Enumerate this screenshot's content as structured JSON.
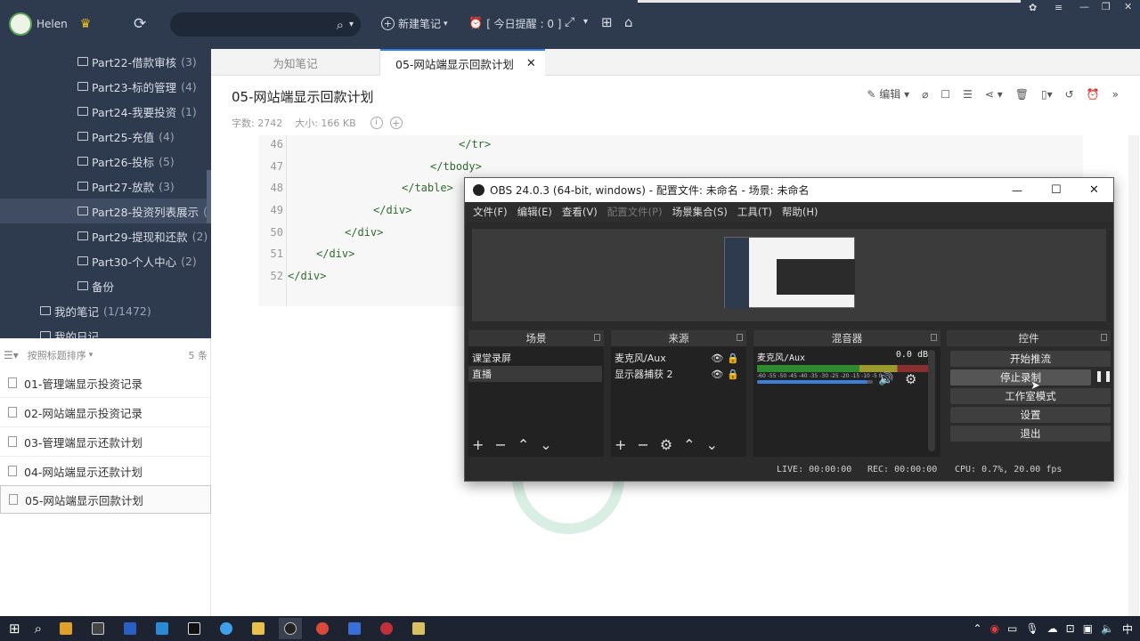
{
  "topbar": {
    "user": "Helen",
    "new_note": "新建笔记",
    "reminder": "[ 今日提醒 : 0 ]"
  },
  "sidebar": {
    "items": [
      {
        "label": "Part22-借款审核",
        "count": "(3)"
      },
      {
        "label": "Part23-标的管理",
        "count": "(4)"
      },
      {
        "label": "Part24-我要投资",
        "count": "(1)"
      },
      {
        "label": "Part25-充值",
        "count": "(4)"
      },
      {
        "label": "Part26-投标",
        "count": "(5)"
      },
      {
        "label": "Part27-放款",
        "count": "(3)"
      },
      {
        "label": "Part28-投资列表展示",
        "count": "("
      },
      {
        "label": "Part29-提现和还款",
        "count": "(2)"
      },
      {
        "label": "Part30-个人中心",
        "count": "(2)"
      },
      {
        "label": "备份",
        "count": ""
      },
      {
        "label": "我的笔记",
        "count": "(1/1472)"
      },
      {
        "label": "我的日记",
        "count": ""
      }
    ]
  },
  "notelist": {
    "sort_label": "按照标题排序",
    "total": "5 条",
    "notes": [
      "01-管理端显示投资记录",
      "02-网站端显示投资记录",
      "03-管理端显示还款计划",
      "04-网站端显示还款计划",
      "05-网站端显示回款计划"
    ]
  },
  "tabs": [
    "为知笔记",
    "05-网站端显示回款计划"
  ],
  "document": {
    "title": "05-网站端显示回款计划",
    "word_count": "字数: 2742",
    "size": "大小: 166 KB",
    "edit_label": "编辑"
  },
  "code": {
    "lines": [
      {
        "no": "46",
        "text": "</tr>"
      },
      {
        "no": "47",
        "text": "</tbody>"
      },
      {
        "no": "48",
        "text": "</table>"
      },
      {
        "no": "49",
        "text": "</div>"
      },
      {
        "no": "50",
        "text": "</div>"
      },
      {
        "no": "51",
        "text": "</div>"
      },
      {
        "no": "52",
        "text": "</div>"
      }
    ]
  },
  "obs": {
    "title": "OBS 24.0.3 (64-bit, windows) - 配置文件: 未命名 - 场景: 未命名",
    "menu": [
      "文件(F)",
      "编辑(E)",
      "查看(V)",
      "配置文件(P)",
      "场景集合(S)",
      "工具(T)",
      "帮助(H)"
    ],
    "docks": {
      "scenes": {
        "title": "场景",
        "items": [
          "课堂录屏",
          "直播"
        ]
      },
      "sources": {
        "title": "来源",
        "items": [
          "麦克风/Aux",
          "显示器捕获 2"
        ]
      },
      "mixer": {
        "title": "混音器",
        "channel": "麦克风/Aux",
        "level": "0.0 dB",
        "ticks": "-60 -55 -50 -45 -40 -35 -30 -25 -20 -15 -10 -5 0",
        "volume": 0.95
      },
      "controls": {
        "title": "控件",
        "buttons": [
          "开始推流",
          "停止录制",
          "工作室模式",
          "设置",
          "退出"
        ]
      }
    },
    "status": {
      "live": "LIVE: 00:00:00",
      "rec": "REC: 00:00:00",
      "cpu": "CPU: 0.7%, 20.00 fps"
    }
  },
  "taskbar": {
    "ime": "中"
  },
  "colors": {
    "sidebar_bg": "#2e3a4d",
    "obs_bg": "#2b2b2b",
    "accent": "#2b7de9"
  }
}
